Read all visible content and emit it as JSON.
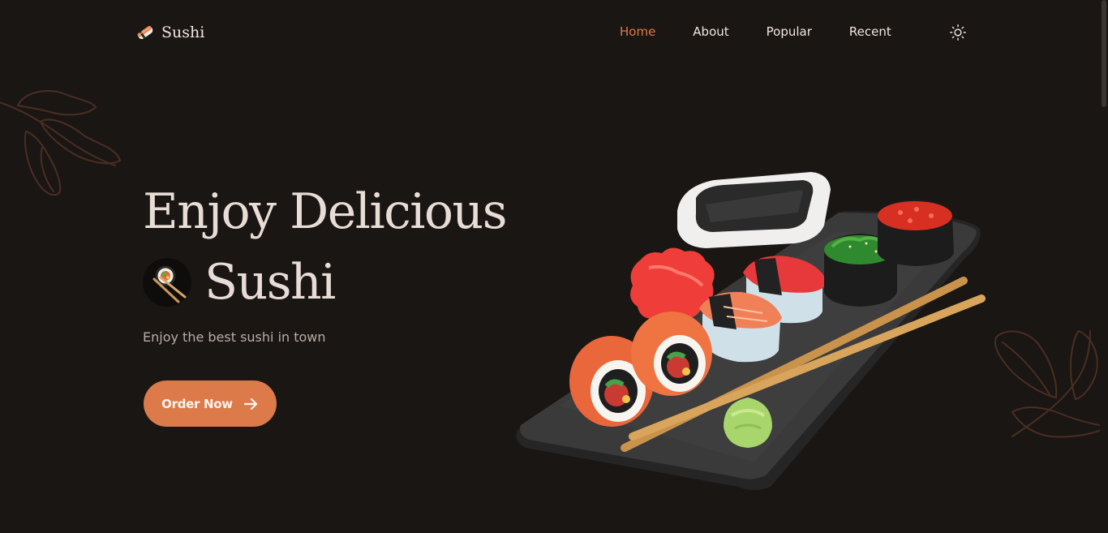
{
  "header": {
    "logo_text": "Sushi",
    "logo_icon": "sushi-roll-icon",
    "nav": [
      {
        "label": "Home",
        "active": true
      },
      {
        "label": "About",
        "active": false
      },
      {
        "label": "Popular",
        "active": false
      },
      {
        "label": "Recent",
        "active": false
      }
    ],
    "theme_icon": "sun-icon"
  },
  "hero": {
    "title_line_1": "Enjoy Delicious",
    "title_line_2": "Sushi",
    "title_icon": "sushi-chopsticks-icon",
    "subtitle": "Enjoy the best sushi in town",
    "button_label": "Order Now",
    "button_icon": "arrow-right-icon",
    "image": "sushi-platter-image"
  },
  "colors": {
    "background": "#1a1614",
    "accent": "#de7a48",
    "text": "#e8dcd6",
    "muted_text": "#b9aca6",
    "leaf_line": "#4a2e22"
  }
}
